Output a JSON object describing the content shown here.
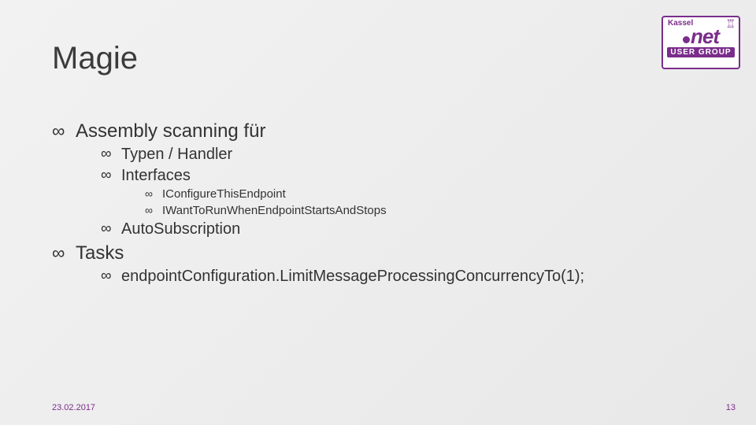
{
  "logo": {
    "top": "Kassel",
    "mid": "net",
    "bottom": "USER GROUP"
  },
  "title": "Magie",
  "bullets": {
    "assembly": "Assembly scanning für",
    "typen": "Typen / Handler",
    "interfaces": "Interfaces",
    "iconfigure": "IConfigureThisEndpoint",
    "iwant": "IWantToRunWhenEndpointStartsAndStops",
    "autosub": "AutoSubscription",
    "tasks": "Tasks",
    "endpoint": "endpointConfiguration.LimitMessageProcessingConcurrencyTo(1);"
  },
  "footer": {
    "date": "23.02.2017",
    "page": "13"
  }
}
